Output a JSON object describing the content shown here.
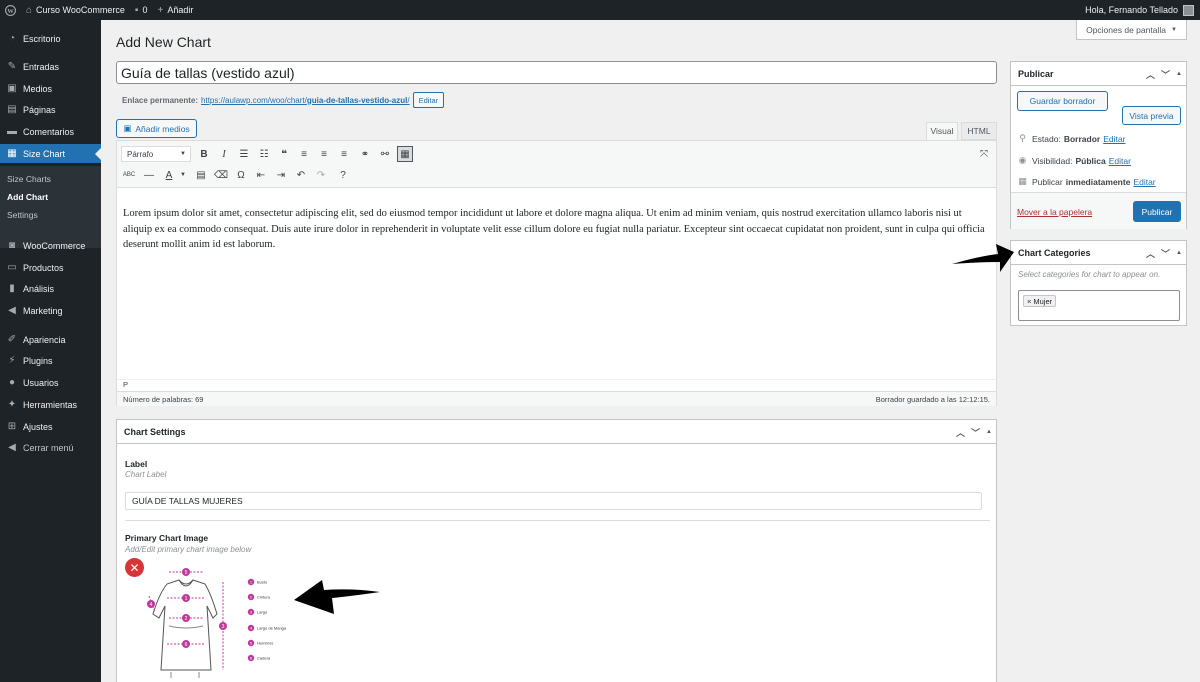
{
  "admin_bar": {
    "site_name": "Curso WooCommerce",
    "comments_count": "0",
    "new_label": "Añadir",
    "greeting": "Hola, Fernando Tellado"
  },
  "sidebar": {
    "items": [
      {
        "label": "Escritorio",
        "icon": "dashboard-icon"
      },
      {
        "label": "Entradas",
        "icon": "pin-icon"
      },
      {
        "label": "Medios",
        "icon": "media-icon"
      },
      {
        "label": "Páginas",
        "icon": "page-icon"
      },
      {
        "label": "Comentarios",
        "icon": "comment-icon"
      },
      {
        "label": "Size Chart",
        "icon": "chart-icon"
      },
      {
        "label": "WooCommerce",
        "icon": "woo-icon"
      },
      {
        "label": "Productos",
        "icon": "archive-icon"
      },
      {
        "label": "Análisis",
        "icon": "bar-chart-icon"
      },
      {
        "label": "Marketing",
        "icon": "megaphone-icon"
      },
      {
        "label": "Apariencia",
        "icon": "brush-icon"
      },
      {
        "label": "Plugins",
        "icon": "plugin-icon"
      },
      {
        "label": "Usuarios",
        "icon": "user-icon"
      },
      {
        "label": "Herramientas",
        "icon": "wrench-icon"
      },
      {
        "label": "Ajustes",
        "icon": "settings-icon"
      },
      {
        "label": "Cerrar menú",
        "icon": "collapse-icon"
      }
    ],
    "submenu": [
      "Size Charts",
      "Add Chart",
      "Settings"
    ]
  },
  "screen_options": "Opciones de pantalla",
  "page_title": "Add New Chart",
  "title_value": "Guía de tallas (vestido azul)",
  "permalink": {
    "label": "Enlace permanente:",
    "url_base": "https://aulawp.com/woo/chart/",
    "slug": "guia-de-tallas-vestido-azul",
    "url_end": "/",
    "edit_label": "Editar"
  },
  "editor": {
    "add_media": "Añadir medios",
    "tab_visual": "Visual",
    "tab_html": "HTML",
    "format": "Párrafo",
    "content": "Lorem ipsum dolor sit amet, consectetur adipiscing elit, sed do eiusmod tempor incididunt ut labore et dolore magna aliqua. Ut enim ad minim veniam, quis nostrud exercitation ullamco laboris nisi ut aliquip ex ea commodo consequat. Duis aute irure dolor in reprehenderit in voluptate velit esse cillum dolore eu fugiat nulla pariatur. Excepteur sint occaecat cupidatat non proident, sunt in culpa qui officia deserunt mollit anim id est laborum.",
    "path": "P",
    "word_count": "Número de palabras: 69",
    "draft_saved": "Borrador guardado a las 12:12:15."
  },
  "chart_settings": {
    "title": "Chart Settings",
    "label_title": "Label",
    "label_desc": "Chart Label",
    "label_value": "GUÍA DE TALLAS MUJERES",
    "image_title": "Primary Chart Image",
    "image_desc": "Add/Edit primary chart image below",
    "legend": [
      "Busto",
      "Cintura",
      "Largo",
      "Largo de Manga",
      "Hombros",
      "Cadera"
    ]
  },
  "publish": {
    "title": "Publicar",
    "save_draft": "Guardar borrador",
    "preview": "Vista previa",
    "status_label": "Estado:",
    "status_value": "Borrador",
    "visibility_label": "Visibilidad:",
    "visibility_value": "Pública",
    "publish_label": "Publicar",
    "publish_value": "inmediatamente",
    "edit": "Editar",
    "trash": "Mover a la papelera",
    "publish_btn": "Publicar"
  },
  "chart_categories": {
    "title": "Chart Categories",
    "desc": "Select categories for chart to appear on.",
    "chip": "Mujer"
  },
  "colors": {
    "accent": "#2271b1",
    "admin_dark": "#1d2327",
    "diagram_magenta": "#c0399a",
    "danger": "#d63638"
  }
}
